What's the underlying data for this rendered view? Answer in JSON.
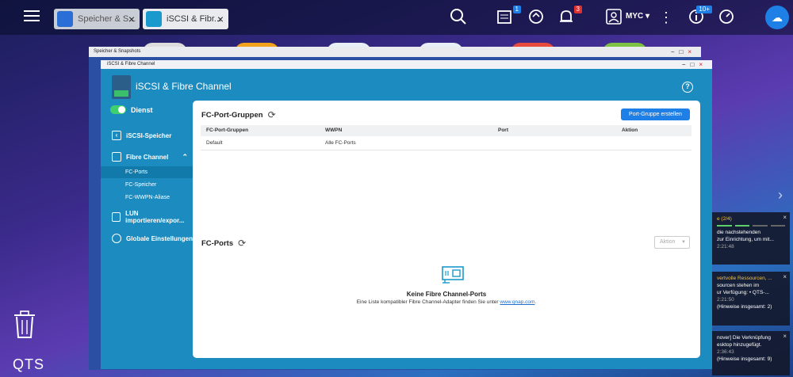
{
  "taskbar": {
    "tabs": [
      {
        "label": "Speicher & S..."
      },
      {
        "label": "iSCSI & Fibr..."
      }
    ],
    "badges": {
      "notifications_tasks": "1",
      "alerts": "3",
      "updates": "10+"
    },
    "user": "MYC"
  },
  "bg_window": {
    "title": "Speicher & Snapshots"
  },
  "main_window": {
    "title": "iSCSI & Fibre Channel",
    "app_title": "iSCSI & Fibre Channel"
  },
  "sidebar": {
    "service_label": "Dienst",
    "items": [
      {
        "label": "iSCSI-Speicher"
      },
      {
        "label": "Fibre Channel"
      },
      {
        "label": "LUN importieren/expor..."
      },
      {
        "label": "Globale Einstellungen"
      }
    ],
    "sub_items": [
      {
        "label": "FC-Ports"
      },
      {
        "label": "FC-Speicher"
      },
      {
        "label": "FC-WWPN-Aliase"
      }
    ]
  },
  "groups_section": {
    "title": "FC-Port-Gruppen",
    "create_button": "Port-Gruppe erstellen",
    "columns": [
      "FC-Port-Gruppen",
      "WWPN",
      "Port",
      "Aktion"
    ],
    "rows": [
      [
        "Default",
        "Alle FC-Ports",
        "",
        ""
      ]
    ]
  },
  "ports_section": {
    "title": "FC-Ports",
    "action_select": "Aktion",
    "empty_title": "Keine Fibre Channel-Ports",
    "empty_desc": "Eine Liste kompatibler Fibre Channel-Adapter finden Sie unter",
    "empty_link": "www.qnap.com",
    "empty_desc_end": "."
  },
  "notifications": [
    {
      "title": "e (2/4)",
      "body": "die nachstehenden\n zur Einrichtung, um mit...",
      "time": "2:21:48"
    },
    {
      "title": "vertvolle Ressourcen, ...",
      "body": "sourcen stehen im\nur Verfügung: • QTS-...",
      "time": "2:21:50",
      "note": "(Hinweise insgesamt: 2)"
    },
    {
      "title": "",
      "body": "nover] Die Verknüpfung\nesktop hinzugefügt.",
      "time": "2:36:43",
      "note": "(Hinweise insgesamt: 9)"
    }
  ],
  "desktop": {
    "logo": "QTS"
  },
  "colors": {
    "accent": "#1e7fe6",
    "header": "#1c8bbf",
    "toggle_on": "#3fcf6e"
  },
  "icons": [
    "search-icon",
    "task-icon",
    "sync-icon",
    "bell-icon",
    "user-icon",
    "more-icon",
    "info-icon",
    "gauge-icon",
    "cloud-icon",
    "refresh-icon",
    "help-icon",
    "trash-icon"
  ]
}
